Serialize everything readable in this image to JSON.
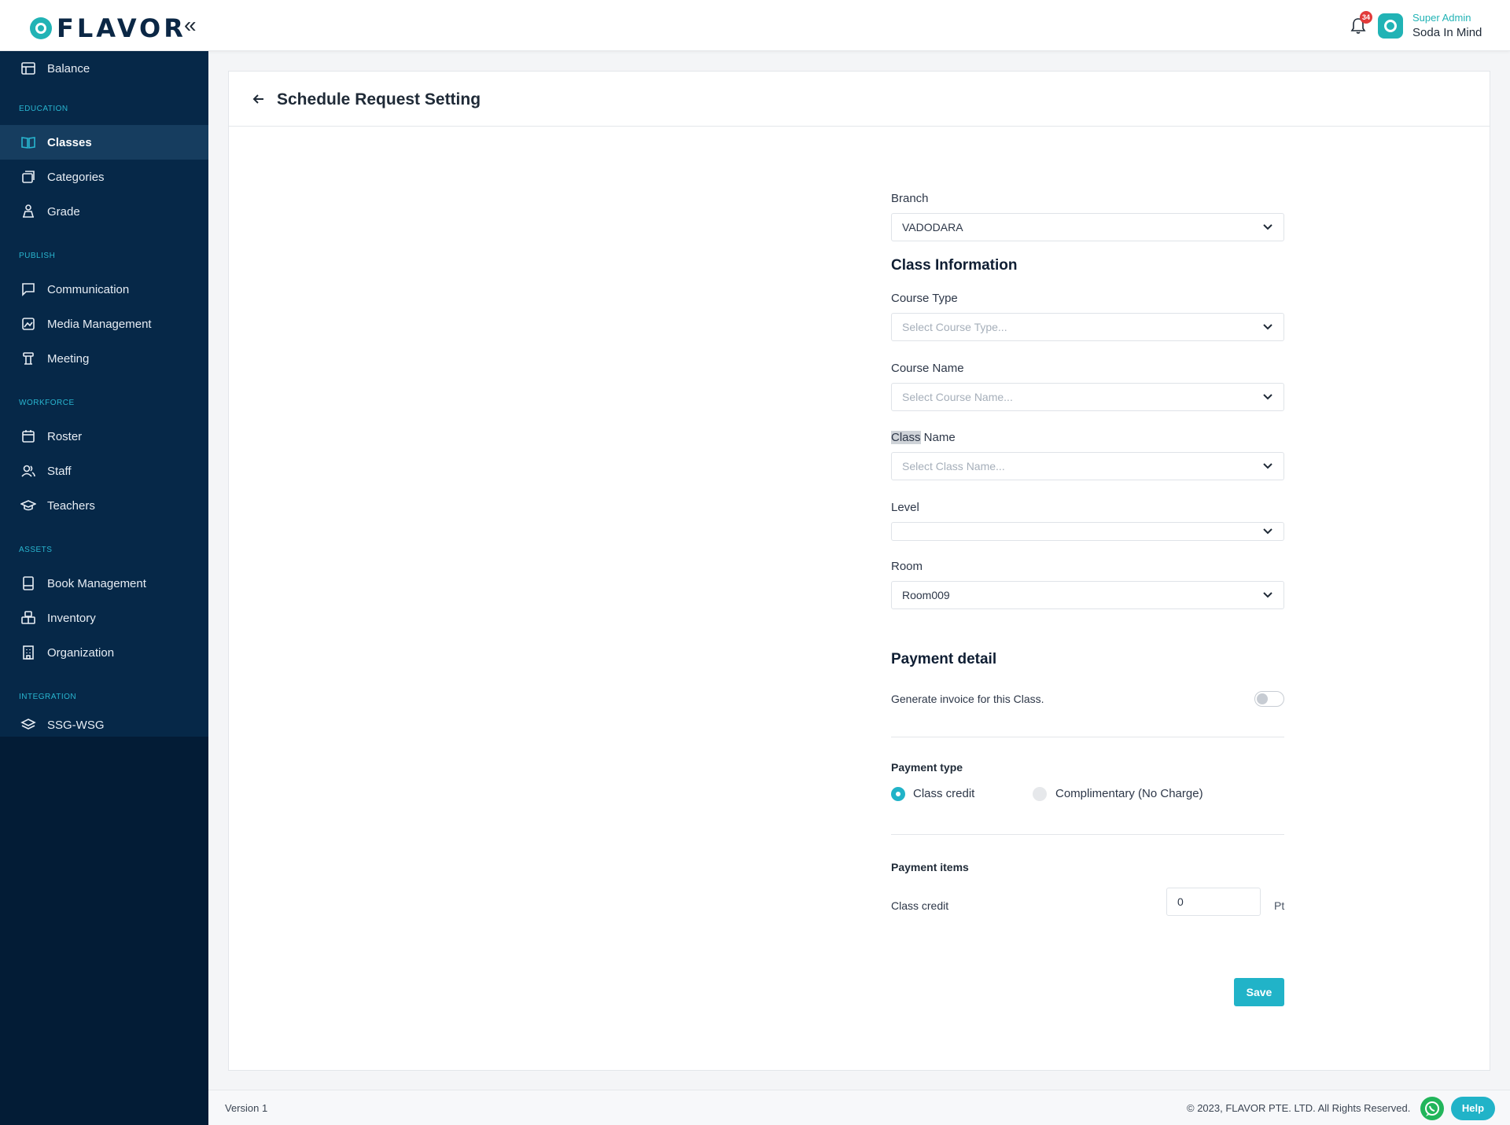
{
  "header": {
    "logo_text": "FLAVOR",
    "notification_count": "34",
    "user_role": "Super Admin",
    "user_name": "Soda In Mind"
  },
  "sidebar": {
    "top_item": "Balance",
    "sections": [
      {
        "title": "EDUCATION",
        "items": [
          "Classes",
          "Categories",
          "Grade"
        ]
      },
      {
        "title": "PUBLISH",
        "items": [
          "Communication",
          "Media Management",
          "Meeting"
        ]
      },
      {
        "title": "WORKFORCE",
        "items": [
          "Roster",
          "Staff",
          "Teachers"
        ]
      },
      {
        "title": "ASSETS",
        "items": [
          "Book Management",
          "Inventory",
          "Organization"
        ]
      },
      {
        "title": "INTEGRATION",
        "items": [
          "SSG-WSG"
        ]
      }
    ],
    "active_item": "Classes"
  },
  "page": {
    "title": "Schedule Request Setting"
  },
  "form": {
    "branch_label": "Branch",
    "branch_value": "VADODARA",
    "class_info_title": "Class Information",
    "course_type_label": "Course Type",
    "course_type_placeholder": "Select Course Type...",
    "course_name_label": "Course Name",
    "course_name_placeholder": "Select Course Name...",
    "class_name_label_highlighted": "Class",
    "class_name_label_rest": " Name",
    "class_name_placeholder": "Select Class Name...",
    "level_label": "Level",
    "level_value": "",
    "room_label": "Room",
    "room_value": "Room009",
    "payment_detail_title": "Payment detail",
    "generate_invoice_label": "Generate invoice for this Class.",
    "generate_invoice_on": false,
    "payment_type_title": "Payment type",
    "payment_type_options": [
      "Class credit",
      "Complimentary (No Charge)"
    ],
    "payment_type_selected": "Class credit",
    "payment_items_title": "Payment items",
    "class_credit_label": "Class credit",
    "class_credit_value": "0",
    "class_credit_unit": "Pt",
    "save_label": "Save"
  },
  "footer": {
    "version": "Version 1",
    "copyright": "© 2023, FLAVOR PTE. LTD. All Rights Reserved.",
    "help_label": "Help"
  },
  "colors": {
    "accent": "#21b3c8",
    "sidebar_bg": "#062848",
    "sidebar_active": "#163d5f",
    "section_title": "#29b6d0"
  }
}
